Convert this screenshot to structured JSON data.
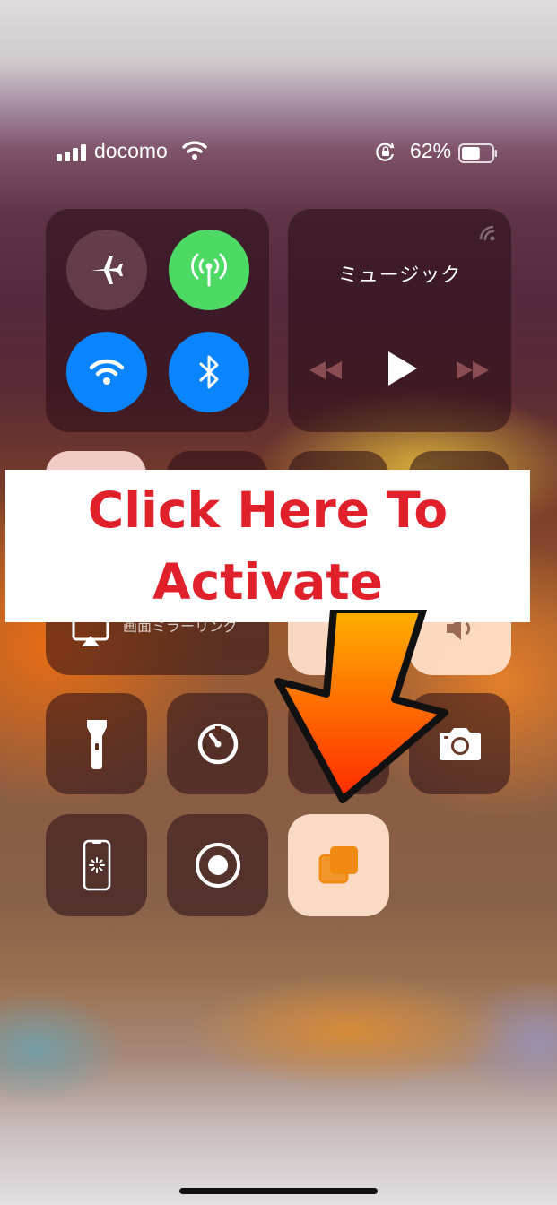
{
  "status_bar": {
    "carrier": "docomo",
    "battery_percent": "62%",
    "battery_level": 0.62
  },
  "connectivity": {
    "airplane_mode": "off",
    "cellular_data": "on",
    "wifi": "on",
    "bluetooth": "on"
  },
  "music": {
    "title": "ミュージック"
  },
  "screen_mirroring": {
    "label": "画面ミラーリング"
  },
  "banner": {
    "line1": "Click Here To",
    "line2": "Activate",
    "color": "#e0202a"
  },
  "colors": {
    "cellular_green": "#4cd964",
    "active_blue": "#0a84ff",
    "highlight_tile": "#ffdcc8",
    "icon_orange": "#f08a10"
  },
  "icons": [
    "airplane-icon",
    "cellular-antenna-icon",
    "wifi-icon",
    "bluetooth-icon",
    "airplay-icon",
    "rewind-icon",
    "play-icon",
    "fast-forward-icon",
    "screen-mirroring-icon",
    "speaker-icon",
    "flashlight-icon",
    "timer-icon",
    "camera-icon",
    "orientation-lock-icon",
    "screen-record-icon",
    "stacked-squares-icon"
  ]
}
